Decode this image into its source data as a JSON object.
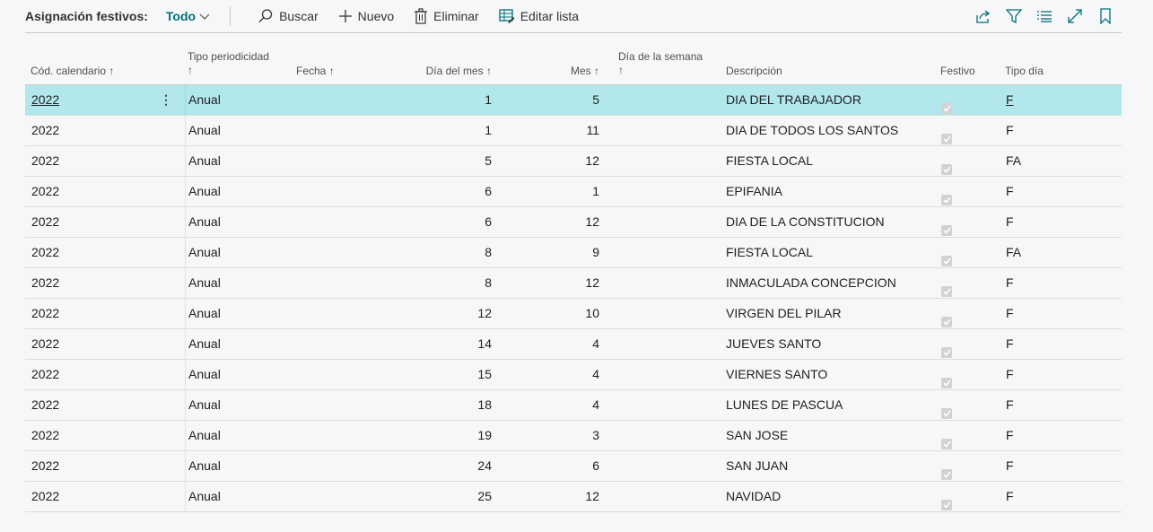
{
  "toolbar": {
    "title": "Asignación festivos:",
    "view": "Todo",
    "actions": [
      {
        "label": "Buscar",
        "icon": "search-icon"
      },
      {
        "label": "Nuevo",
        "icon": "plus-icon"
      },
      {
        "label": "Eliminar",
        "icon": "trash-icon"
      },
      {
        "label": "Editar lista",
        "icon": "edit-list-icon"
      }
    ],
    "right_icons": [
      "share-icon",
      "filter-icon",
      "list-view-icon",
      "expand-icon",
      "bookmark-icon"
    ],
    "accent_color": "#00707a"
  },
  "columns": {
    "cod": "Cód. calendario",
    "tipo_line1": "Tipo periodicidad",
    "fecha": "Fecha",
    "dia_mes": "Día del mes",
    "mes": "Mes",
    "dia_sem_line1": "Día de la semana",
    "descripcion": "Descripción",
    "festivo": "Festivo",
    "tipo_dia": "Tipo día",
    "sort_arrow": "↑"
  },
  "selected_row_color": "#b2e8ec",
  "rows": [
    {
      "cod": "2022",
      "tipo": "Anual",
      "dia": "1",
      "mes": "5",
      "desc": "DIA DEL TRABAJADOR",
      "festivo": true,
      "tdia": "F",
      "selected": true
    },
    {
      "cod": "2022",
      "tipo": "Anual",
      "dia": "1",
      "mes": "11",
      "desc": "DIA DE TODOS LOS SANTOS",
      "festivo": true,
      "tdia": "F"
    },
    {
      "cod": "2022",
      "tipo": "Anual",
      "dia": "5",
      "mes": "12",
      "desc": "FIESTA LOCAL",
      "festivo": true,
      "tdia": "FA"
    },
    {
      "cod": "2022",
      "tipo": "Anual",
      "dia": "6",
      "mes": "1",
      "desc": "EPIFANIA",
      "festivo": true,
      "tdia": "F"
    },
    {
      "cod": "2022",
      "tipo": "Anual",
      "dia": "6",
      "mes": "12",
      "desc": "DIA DE LA CONSTITUCION",
      "festivo": true,
      "tdia": "F"
    },
    {
      "cod": "2022",
      "tipo": "Anual",
      "dia": "8",
      "mes": "9",
      "desc": "FIESTA LOCAL",
      "festivo": true,
      "tdia": "FA"
    },
    {
      "cod": "2022",
      "tipo": "Anual",
      "dia": "8",
      "mes": "12",
      "desc": "INMACULADA CONCEPCION",
      "festivo": true,
      "tdia": "F"
    },
    {
      "cod": "2022",
      "tipo": "Anual",
      "dia": "12",
      "mes": "10",
      "desc": "VIRGEN DEL PILAR",
      "festivo": true,
      "tdia": "F"
    },
    {
      "cod": "2022",
      "tipo": "Anual",
      "dia": "14",
      "mes": "4",
      "desc": "JUEVES SANTO",
      "festivo": true,
      "tdia": "F"
    },
    {
      "cod": "2022",
      "tipo": "Anual",
      "dia": "15",
      "mes": "4",
      "desc": "VIERNES SANTO",
      "festivo": true,
      "tdia": "F"
    },
    {
      "cod": "2022",
      "tipo": "Anual",
      "dia": "18",
      "mes": "4",
      "desc": "LUNES DE PASCUA",
      "festivo": true,
      "tdia": "F"
    },
    {
      "cod": "2022",
      "tipo": "Anual",
      "dia": "19",
      "mes": "3",
      "desc": "SAN JOSE",
      "festivo": true,
      "tdia": "F"
    },
    {
      "cod": "2022",
      "tipo": "Anual",
      "dia": "24",
      "mes": "6",
      "desc": "SAN JUAN",
      "festivo": true,
      "tdia": "F"
    },
    {
      "cod": "2022",
      "tipo": "Anual",
      "dia": "25",
      "mes": "12",
      "desc": "NAVIDAD",
      "festivo": true,
      "tdia": "F"
    }
  ]
}
